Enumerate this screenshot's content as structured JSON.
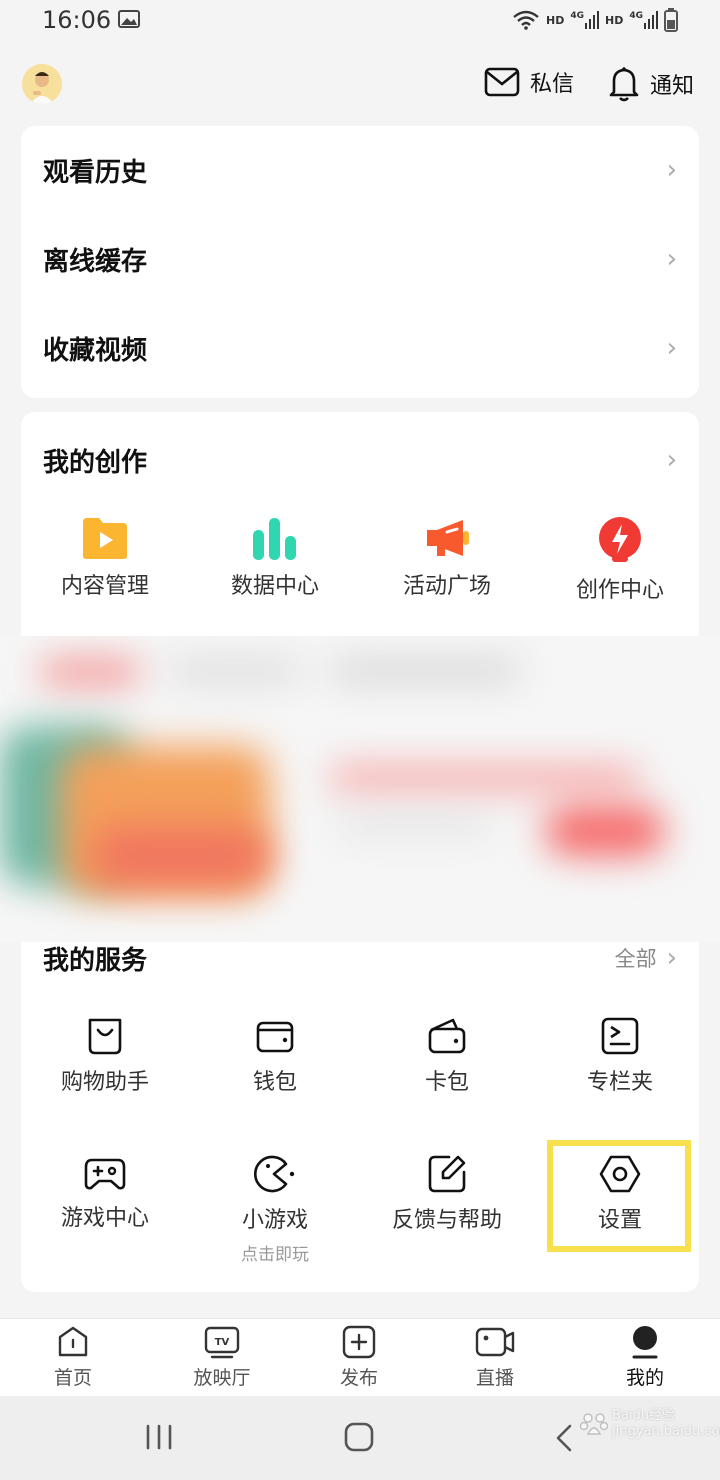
{
  "status_bar": {
    "time": "16:06",
    "network_1": "HD",
    "network_2": "HD",
    "signal_1": "4G",
    "signal_2": "4G"
  },
  "header": {
    "messages_label": "私信",
    "notifications_label": "通知"
  },
  "quick_list": [
    {
      "label": "观看历史"
    },
    {
      "label": "离线缓存"
    },
    {
      "label": "收藏视频"
    }
  ],
  "creation": {
    "title": "我的创作",
    "items": [
      {
        "label": "内容管理",
        "icon": "folder-play-icon",
        "color": "#fbb531"
      },
      {
        "label": "数据中心",
        "icon": "bar-chart-icon",
        "color": "#2fd6b0"
      },
      {
        "label": "活动广场",
        "icon": "megaphone-icon",
        "color": "#f85a2e"
      },
      {
        "label": "创作中心",
        "icon": "bolt-badge-icon",
        "color": "#f03a33"
      }
    ]
  },
  "services": {
    "title": "我的服务",
    "all_label": "全部",
    "items": [
      {
        "label": "购物助手",
        "icon": "shopping-bag-icon"
      },
      {
        "label": "钱包",
        "icon": "wallet-icon"
      },
      {
        "label": "卡包",
        "icon": "card-holder-icon"
      },
      {
        "label": "专栏夹",
        "icon": "column-folder-icon"
      },
      {
        "label": "游戏中心",
        "icon": "gamepad-icon"
      },
      {
        "label": "小游戏",
        "sublabel": "点击即玩",
        "icon": "pacman-icon"
      },
      {
        "label": "反馈与帮助",
        "icon": "edit-icon"
      },
      {
        "label": "设置",
        "icon": "settings-hexagon-icon"
      }
    ]
  },
  "bottom_nav": [
    {
      "label": "首页",
      "icon": "home-icon"
    },
    {
      "label": "放映厅",
      "icon": "tv-icon"
    },
    {
      "label": "发布",
      "icon": "plus-square-icon"
    },
    {
      "label": "直播",
      "icon": "video-camera-icon"
    },
    {
      "label": "我的",
      "icon": "profile-icon",
      "active": true
    }
  ],
  "highlight_color": "#f8df4e",
  "watermark": "Baidu经验 jingyan.baidu.com"
}
